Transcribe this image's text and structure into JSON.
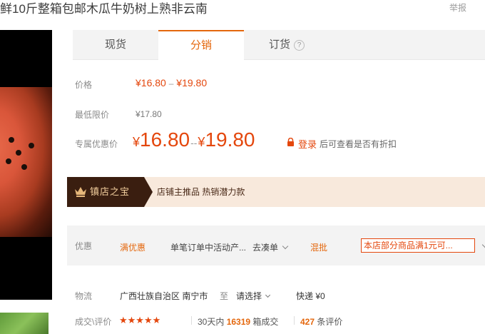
{
  "product": {
    "title": "鲜10斤整箱包邮木瓜牛奶树上熟非云南",
    "report": "举报"
  },
  "tabs": [
    {
      "label": "现货"
    },
    {
      "label": "分销"
    },
    {
      "label": "订货"
    }
  ],
  "pricing": {
    "price_label": "价格",
    "price_low": "¥16.80",
    "price_sep": "–",
    "price_high": "¥19.80",
    "min_label": "最低限价",
    "min_price": "¥17.80",
    "special_label": "专属优惠价",
    "special_yen": "¥",
    "special_low": "16.80",
    "special_sep": "--",
    "special_high": "19.80",
    "login_link": "登录",
    "login_note": "后可查看是否有折扣"
  },
  "treasure": {
    "title": "镇店之宝",
    "tags": "店铺主推品  热销潜力款"
  },
  "promotion": {
    "label": "优惠",
    "tag1": "满优惠",
    "text1": "单笔订单中活动产...",
    "link1": "去凑单",
    "tag2": "混批",
    "box_text": "本店部分商品满1元可..."
  },
  "logistics": {
    "label": "物流",
    "region": "广西壮族自治区 南宁市",
    "to": "至",
    "select": "请选择",
    "shipping": "快递 ¥0"
  },
  "reviews": {
    "label": "成交\\评价",
    "stars": "★★★★★",
    "rating": 5,
    "sales_prefix": "30天内",
    "sales_count": "16319",
    "sales_suffix": "箱成交",
    "review_count": "427",
    "review_suffix": "条评价"
  },
  "colors": {
    "accent": "#e4670d",
    "price": "#e4470d",
    "treasure_bg": "#f8e9dc",
    "treasure_badge": "#3a1e10"
  }
}
